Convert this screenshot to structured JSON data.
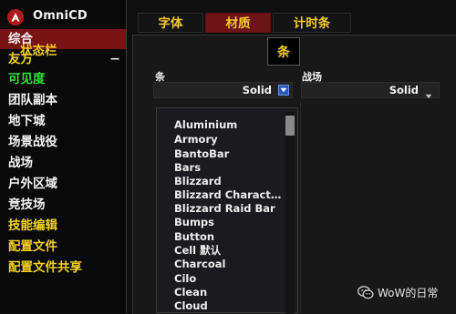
{
  "app": {
    "title": "OmniCD"
  },
  "sidebar": {
    "items": [
      {
        "label": "综合",
        "selected": true
      },
      {
        "label": "友方",
        "expander": "−"
      },
      {
        "label": "可见度"
      },
      {
        "label": "团队副本"
      },
      {
        "label": "地下城"
      },
      {
        "label": "场景战役"
      },
      {
        "label": "战场"
      },
      {
        "label": "户外区域"
      },
      {
        "label": "竞技场"
      },
      {
        "label": "技能编辑"
      },
      {
        "label": "配置文件"
      },
      {
        "label": "配置文件共享"
      }
    ]
  },
  "tabs": [
    {
      "label": "字体"
    },
    {
      "label": "材质",
      "active": true
    },
    {
      "label": "计时条"
    }
  ],
  "section": {
    "title": "状态栏"
  },
  "tooltip": {
    "text": "条"
  },
  "fields": {
    "bar": {
      "label": "条",
      "value": "Solid"
    },
    "battlefield": {
      "label": "战场",
      "value": "Solid"
    }
  },
  "dropdown": {
    "options": [
      "Aluminium",
      "Armory",
      "BantoBar",
      "Bars",
      "Blizzard",
      "Blizzard Charact…",
      "Blizzard Raid Bar",
      "Bumps",
      "Button",
      "Cell 默认",
      "Charcoal",
      "Cilo",
      "Clean",
      "Cloud"
    ]
  },
  "watermark": {
    "text": "WoW的日常"
  },
  "colors": {
    "accent_red": "#7a1315",
    "label_yellow": "#f1cb22",
    "label_green": "#2ee03a",
    "dropdown_button": "#2a58c0"
  }
}
